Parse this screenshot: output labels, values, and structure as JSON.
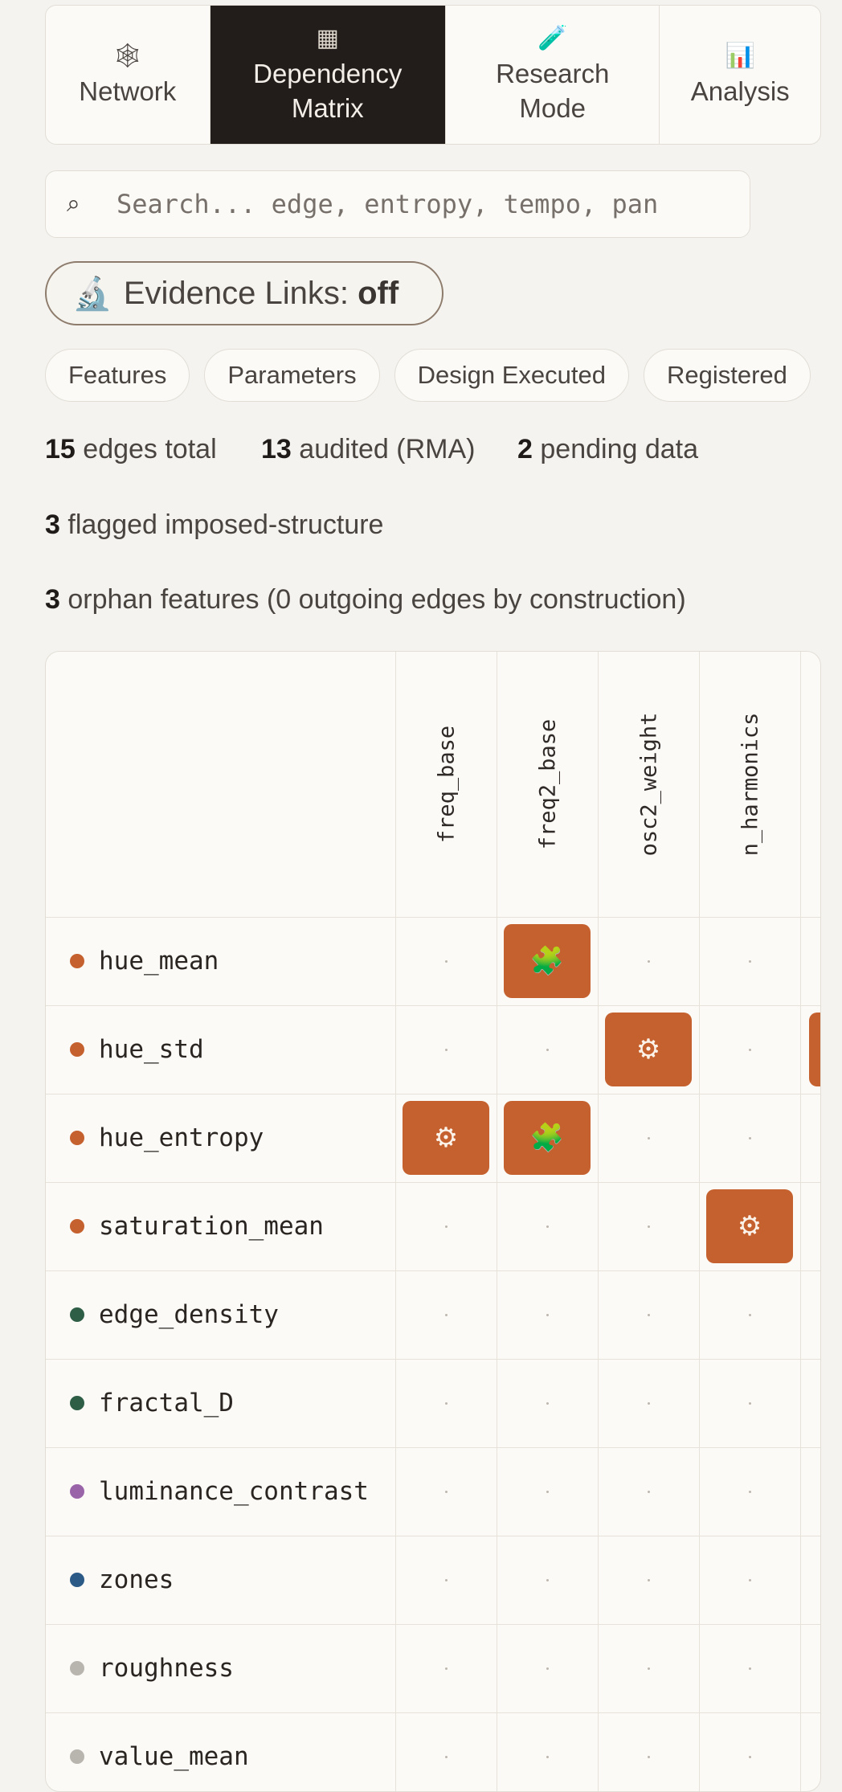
{
  "tabs": [
    {
      "label": "Network",
      "icon": "🕸"
    },
    {
      "label": "Dependency\nMatrix",
      "icon": "▦"
    },
    {
      "label": "Research\nMode",
      "icon": "🧪"
    },
    {
      "label": "Analysis",
      "icon": "📊"
    }
  ],
  "search": {
    "placeholder": "Search... edge, entropy, tempo, pan",
    "icon": "⌕"
  },
  "evidence": {
    "label": "Evidence Links:",
    "state": "off",
    "icon": "🔬"
  },
  "filters": [
    "Features",
    "Parameters",
    "Design Executed",
    "Registered"
  ],
  "stats": {
    "edges_total_num": "15",
    "edges_total_text": "edges total",
    "audited_num": "13",
    "audited_text": "audited (RMA)",
    "pending_num": "2",
    "pending_text": "pending data",
    "flagged_num": "3",
    "flagged_text": "flagged imposed-structure",
    "orphan_num": "3",
    "orphan_text": "orphan features (0 outgoing edges by construction)"
  },
  "matrix": {
    "columns": [
      "freq_base",
      "freq2_base",
      "osc2_weight",
      "n_harmonics"
    ],
    "rows": [
      {
        "name": "hue_mean",
        "color": "#c5612e",
        "cells": [
          "",
          "puzzle",
          "",
          ""
        ]
      },
      {
        "name": "hue_std",
        "color": "#c5612e",
        "cells": [
          "",
          "",
          "gear",
          ""
        ]
      },
      {
        "name": "hue_entropy",
        "color": "#c5612e",
        "cells": [
          "gear",
          "puzzle",
          "",
          ""
        ]
      },
      {
        "name": "saturation_mean",
        "color": "#c5612e",
        "cells": [
          "",
          "",
          "",
          "gear"
        ]
      },
      {
        "name": "edge_density",
        "color": "#2e5e45",
        "cells": [
          "",
          "",
          "",
          ""
        ]
      },
      {
        "name": "fractal_D",
        "color": "#2e5e45",
        "cells": [
          "",
          "",
          "",
          ""
        ]
      },
      {
        "name": "luminance_contrast",
        "color": "#9a64a8",
        "cells": [
          "",
          "",
          "",
          ""
        ]
      },
      {
        "name": "zones",
        "color": "#2b5a86",
        "cells": [
          "",
          "",
          "",
          ""
        ]
      },
      {
        "name": "roughness",
        "color": "#b8b4ae",
        "cells": [
          "",
          "",
          "",
          ""
        ]
      },
      {
        "name": "value_mean",
        "color": "#b8b4ae",
        "cells": [
          "",
          "",
          "",
          ""
        ]
      }
    ],
    "icons": {
      "puzzle": "🧩",
      "gear": "⚙"
    }
  }
}
